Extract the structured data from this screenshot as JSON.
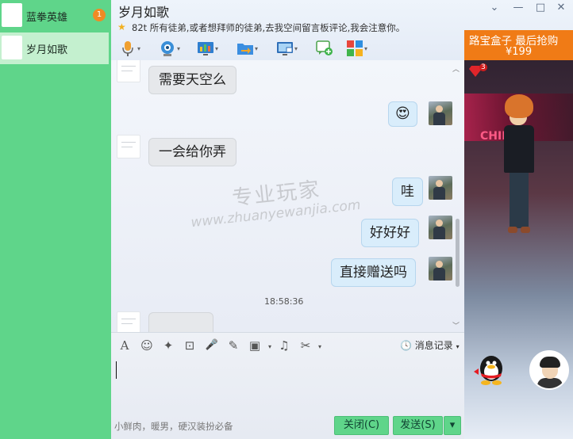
{
  "contacts": [
    {
      "name": "蓝拳英雄",
      "badge": "1"
    },
    {
      "name": "岁月如歌"
    }
  ],
  "chat_title": "岁月如歌",
  "window_controls": {
    "more": "⌄",
    "minimize": "—",
    "maximize": "□",
    "close": "✕"
  },
  "signature": "82t 所有徒弟,或者想拜师的徒弟,去我空间留言板评论,我会注意你。",
  "toolbar_icons": [
    "microphone-icon",
    "camera-icon",
    "screen-share-icon",
    "file-transfer-icon",
    "remote-desktop-icon",
    "add-app-icon",
    "apps-grid-icon"
  ],
  "messages": [
    {
      "from": "other",
      "text": "需要天空么"
    },
    {
      "from": "me",
      "text": "😍"
    },
    {
      "from": "other",
      "text": "一会给你弄"
    },
    {
      "from": "me",
      "text": "哇"
    },
    {
      "from": "me",
      "text": "好好好"
    },
    {
      "from": "me",
      "text": "直接赠送吗"
    },
    {
      "from": "other",
      "text": ""
    }
  ],
  "timestamp": "18:58:36",
  "watermark": {
    "line1": "专业玩家",
    "line2": "www.zhuanyewanjia.com"
  },
  "input_toolbar": {
    "font": "A",
    "emoji": "☺",
    "shake": "✦",
    "gif": "⊡",
    "voice": "🎤",
    "edit": "✎",
    "image": "▣",
    "music": "♫",
    "scissors": "✂",
    "history_label": "消息记录"
  },
  "input_hint": "小鲜肉，暖男，硬汉装扮必备",
  "buttons": {
    "close": "关闭(C)",
    "send": "发送(S)",
    "send_menu": "▾"
  },
  "promo": {
    "title": "路宝盒子 最后抢购",
    "price": "¥199"
  },
  "promo_gem_count": "3",
  "neon_text": "CHINA"
}
